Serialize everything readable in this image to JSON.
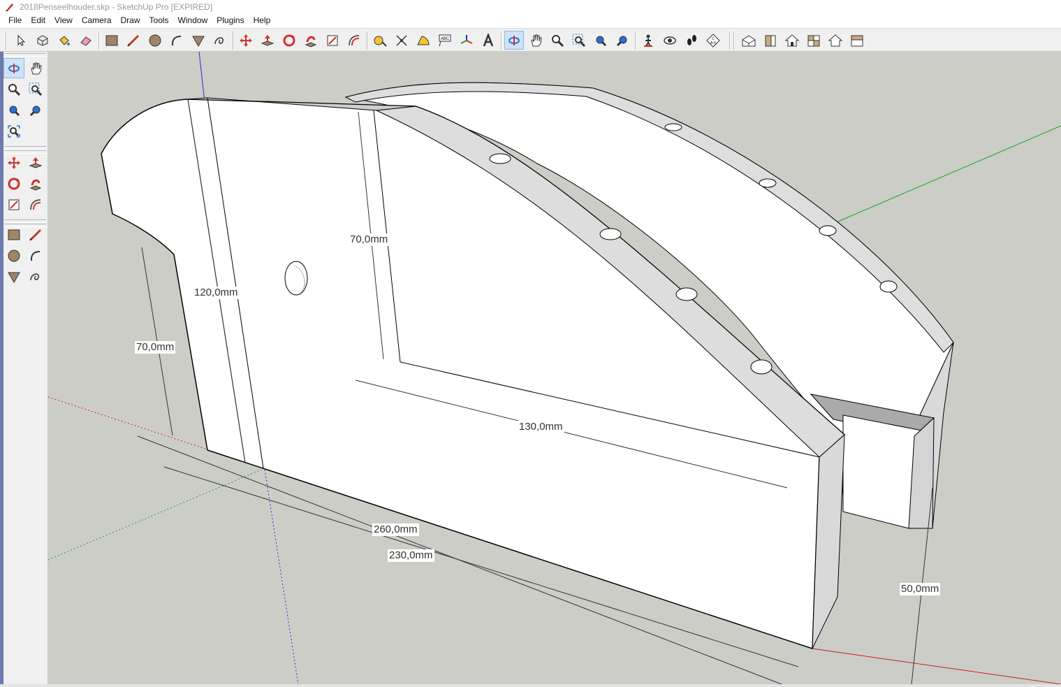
{
  "window": {
    "title": "2018Penseelhouder.skp - SketchUp Pro [EXPIRED]"
  },
  "menu": {
    "items": [
      "File",
      "Edit",
      "View",
      "Camera",
      "Draw",
      "Tools",
      "Window",
      "Plugins",
      "Help"
    ]
  },
  "toolbar": {
    "icons": [
      "select-icon",
      "make-component-icon",
      "paint-bucket-icon",
      "eraser-icon",
      "rectangle-icon",
      "line-icon",
      "circle-icon",
      "arc-icon",
      "polygon-icon",
      "freehand-icon",
      "move-icon",
      "push-pull-icon",
      "rotate-icon",
      "follow-me-icon",
      "scale-icon",
      "offset-icon",
      "tape-measure-icon",
      "dimension-icon",
      "protractor-icon",
      "text-icon",
      "axes-icon",
      "3d-text-icon",
      "orbit-icon",
      "pan-icon",
      "zoom-icon",
      "zoom-window-icon",
      "previous-view-icon",
      "next-view-icon",
      "position-camera-icon",
      "look-around-icon",
      "walk-icon",
      "section-plane-icon",
      "iso-view-icon",
      "front-view-icon",
      "top-view-icon",
      "right-view-icon",
      "back-view-icon",
      "left-view-icon"
    ]
  },
  "left_toolbar": {
    "icons": [
      "orbit-icon",
      "pan-icon",
      "zoom-icon",
      "zoom-window-icon",
      "previous-view-icon",
      "next-view-icon",
      "zoom-extents-icon",
      "move-icon",
      "push-pull-icon",
      "rotate-icon",
      "follow-me-icon",
      "scale-icon",
      "offset-icon",
      "rectangle-icon",
      "line-icon",
      "circle-icon",
      "arc-icon",
      "polygon-icon",
      "freehand-icon"
    ]
  },
  "viewport": {
    "dimensions": {
      "height_front": "70,0mm",
      "height_back": "120,0mm",
      "height_inner": "70,0mm",
      "depth_inner": "130,0mm",
      "length_total": "260,0mm",
      "length_inner": "230,0mm",
      "width_right": "50,0mm"
    },
    "colors": {
      "background": "#cdcdc8",
      "face": "#ffffff",
      "side_face": "#d9d9d9",
      "edge": "#000000",
      "red_axis": "#d21a1a",
      "green_axis": "#1aa51a",
      "blue_axis": "#2a2ad2"
    }
  }
}
